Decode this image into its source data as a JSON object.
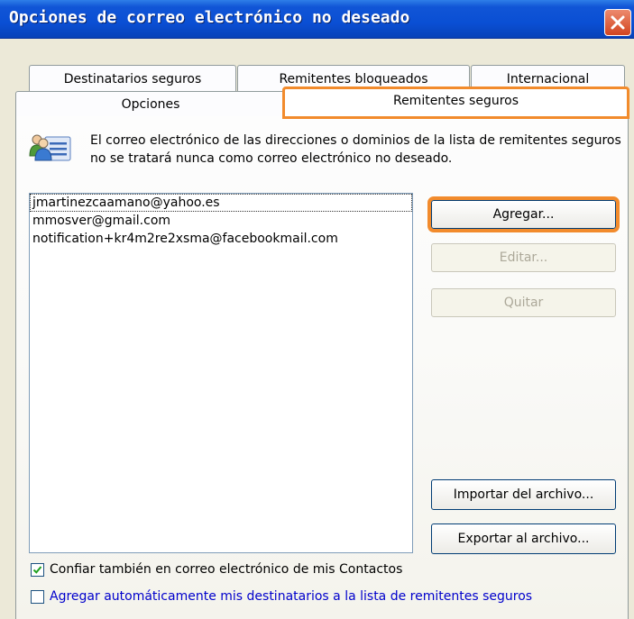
{
  "window": {
    "title": "Opciones de correo electrónico no deseado"
  },
  "tabs": {
    "row1": [
      "Destinatarios seguros",
      "Remitentes bloqueados",
      "Internacional"
    ],
    "row2": [
      "Opciones",
      "Remitentes seguros"
    ],
    "active": "Remitentes seguros"
  },
  "description": "El correo electrónico de las direcciones o dominios de la lista de remitentes seguros no se tratará nunca como correo electrónico no deseado.",
  "safe_senders": [
    "jmartinezcaamano@yahoo.es",
    "mmosver@gmail.com",
    "notification+kr4m2re2xsma@facebookmail.com"
  ],
  "buttons": {
    "add": "Agregar...",
    "edit": "Editar...",
    "remove": "Quitar",
    "import": "Importar del archivo...",
    "export": "Exportar al archivo..."
  },
  "checkboxes": {
    "trust_contacts": {
      "label": "Confiar también en correo electrónico de mis Contactos",
      "checked": true
    },
    "auto_add_recipients": {
      "label": "Agregar automáticamente mis destinatarios a la lista de remitentes seguros",
      "checked": false
    }
  },
  "colors": {
    "highlight": "#f28b2c",
    "titlebar": "#0a4fd4",
    "link_text": "#0000cc"
  },
  "icons": {
    "close": "close-icon",
    "contacts": "contacts-icon",
    "check": "checkmark-icon"
  }
}
